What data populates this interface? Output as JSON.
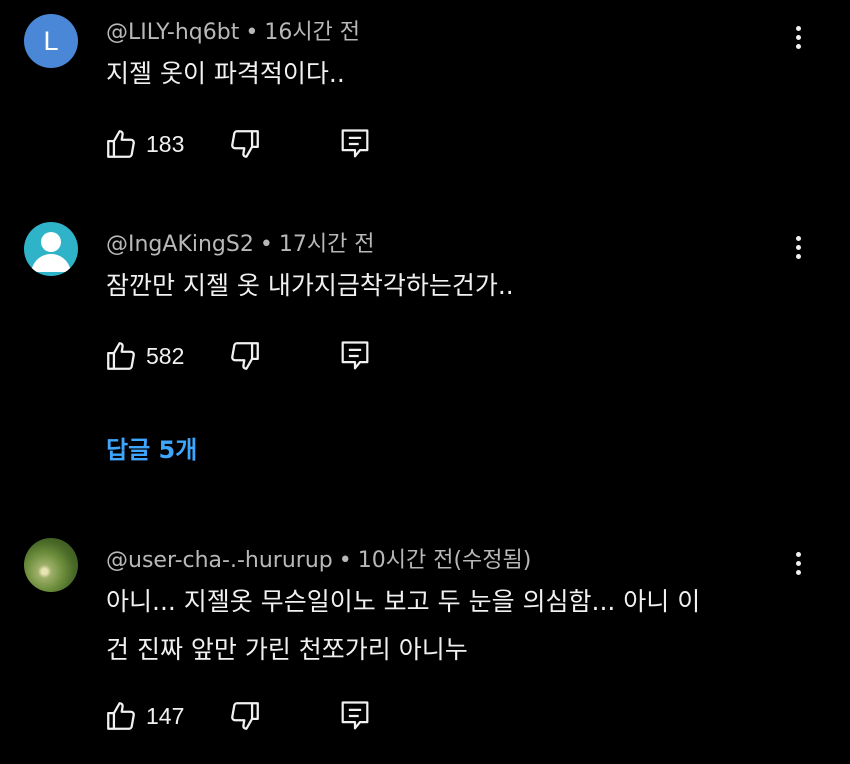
{
  "comments": [
    {
      "avatar_letter": "L",
      "author": "@LILY-hq6bt",
      "time": "16시간 전",
      "text": "지젤 옷이 파격적이다..",
      "likes": "183"
    },
    {
      "avatar_letter": "",
      "author": "@IngAKingS2",
      "time": "17시간 전",
      "text": "잠깐만 지젤 옷 내가지금착각하는건가..",
      "likes": "582"
    },
    {
      "avatar_letter": "",
      "author": "@user-cha-.-hururup",
      "time": "10시간 전(수정됨)",
      "text_lines": [
        "아니... 지젤옷 무슨일이노 보고 두 눈을 의심함... 아니 이",
        "건 진짜 앞만 가린 천쪼가리 아니누"
      ],
      "likes": "147"
    }
  ],
  "replies_link": "답글 5개",
  "separator": "•",
  "colors": {
    "background": "#000000",
    "primary_text": "#f1f1f1",
    "secondary_text": "#b8b8b8",
    "link": "#3ea6ff",
    "avatar_letter_bg": "#4a87d6",
    "avatar_default_bg": "#2fb3c8"
  },
  "icons": {
    "like": "thumbs-up-icon",
    "dislike": "thumbs-down-icon",
    "reply": "reply-comment-icon",
    "more": "vertical-dots-icon"
  }
}
